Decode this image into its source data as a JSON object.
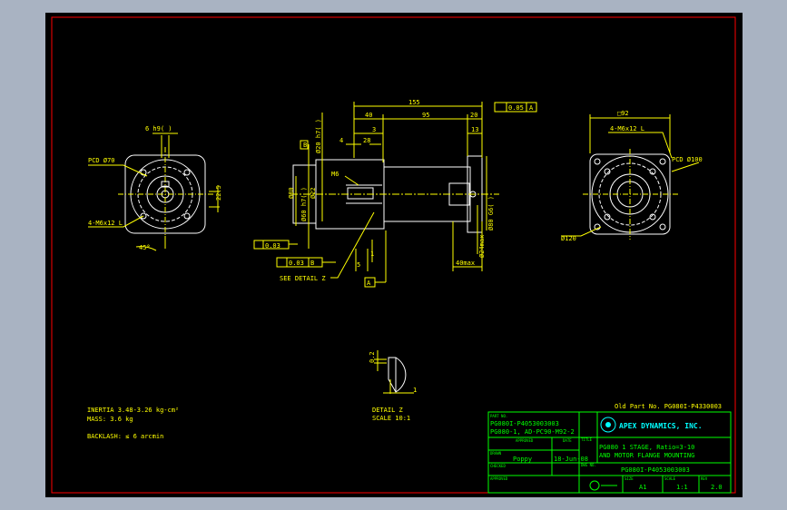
{
  "colors": {
    "background": "#a9b3c2",
    "sheet": "#000000",
    "border": "#ff0000",
    "drawing": "#ffffff",
    "dimension": "#ffff00",
    "titleblock": "#00ff00",
    "logo": "#00ffff"
  },
  "left_view": {
    "key_dim": "6 h9(  )",
    "pcd": "PCD Ø70",
    "holes": "4-M6x12  L",
    "height_dim": "22.5",
    "angle": "45°"
  },
  "side_view": {
    "overall_len": "155",
    "len_40": "40",
    "len_95": "95",
    "len_20": "20",
    "len_3": "3",
    "len_4": "4",
    "len_28": "28",
    "len_13": "13",
    "dia_20": "Ø20 h7(  )",
    "dia_22": "Ø22",
    "dia_80": "Ø80",
    "dia_60": "Ø60 h7(  )",
    "dia_80g6": "Ø80 G6(  )",
    "dia_24": "Ø24max",
    "len_40max": "40max",
    "len_5": "5",
    "len_1": "1",
    "thread": "M6",
    "tol_parallel": "0.05",
    "tol_parallel_ref": "A",
    "tol_perp": "0.03",
    "tol_runout": "0.03",
    "tol_runout_ref": "B",
    "datum_a": "A",
    "datum_b": "B",
    "see_detail": "SEE DETAIL Z"
  },
  "right_view": {
    "square": "□92",
    "holes": "4-M6x12  L",
    "pcd": "PCD Ø100",
    "dia_120": "Ø120"
  },
  "detail": {
    "dim_02": "0.2",
    "dim_1": "1",
    "label": "DETAIL Z",
    "scale": "SCALE 10:1"
  },
  "notes": {
    "inertia": "INERTIA  3.48-3.26 kg-cm²",
    "mass": "MASS: 3.6 kg",
    "backlash": "BACKLASH: ≤ 6 arcmin"
  },
  "titleblock": {
    "old_part": "Old Part No. PG080I-P4330003",
    "part_no_hdr": "PART NO.",
    "part_no_1": "PG080I-P4053003003",
    "part_no_2": "PG080-1, AD-PC90-M92-2",
    "company": "APEX DYNAMICS, INC.",
    "approved_hdr": "APPROVED",
    "date_hdr": "DATE",
    "title_hdr": "TITLE",
    "title_1": "PG080 1 STAGE, Ratio=3-10",
    "title_2": "AND MOTOR FLANGE MOUNTING",
    "drawn_hdr": "DRAWN",
    "drawn_by": "Poppy",
    "drawn_date": "18-Jun-08",
    "checked_hdr": "CHECKED",
    "dwg_hdr": "DWG NO.",
    "dwg_no": "PG080I-P4053003003",
    "approved2_hdr": "APPROVED",
    "size_hdr": "SIZE",
    "size": "A1",
    "scale_hdr": "SCALE",
    "scale": "1:1",
    "rev_hdr": "REV",
    "rev": "2.0"
  }
}
